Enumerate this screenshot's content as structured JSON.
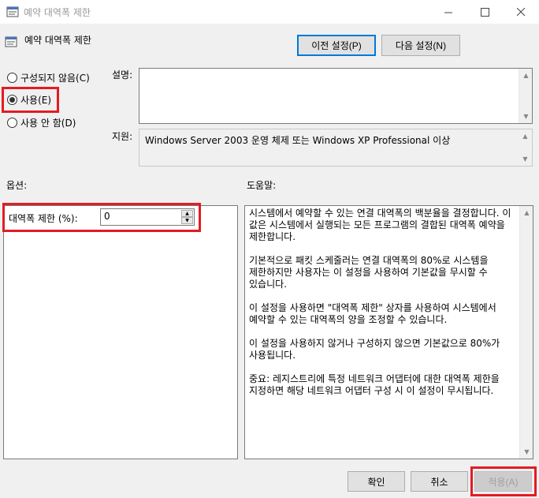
{
  "window": {
    "title": "예약 대역폭 제한",
    "controls": [
      "minimize-icon",
      "maximize-icon",
      "close-icon"
    ]
  },
  "header": {
    "title": "예약 대역폭 제한",
    "prev_setting_label": "이전 설정(P)",
    "next_setting_label": "다음 설정(N)"
  },
  "state": {
    "options": [
      {
        "label": "구성되지 않음(C)",
        "checked": false
      },
      {
        "label": "사용(E)",
        "checked": true
      },
      {
        "label": "사용 안 함(D)",
        "checked": false
      }
    ]
  },
  "comment": {
    "label": "설명:",
    "value": ""
  },
  "supported": {
    "label": "지원:",
    "value": "Windows Server 2003 운영 체제 또는 Windows XP Professional 이상"
  },
  "options_panel": {
    "label": "옵션:",
    "limit_label": "대역폭 제한 (%):",
    "limit_value": "0"
  },
  "help_panel": {
    "label": "도움말:",
    "text": "시스템에서 예약할 수 있는 연결 대역폭의 백분율을 결정합니다. 이 값은 시스템에서 실행되는 모든 프로그램의 결합된 대역폭 예약을 제한합니다.\n\n기본적으로 패킷 스케줄러는 연결 대역폭의 80%로 시스템을 제한하지만 사용자는 이 설정을 사용하여 기본값을 무시할 수 있습니다.\n\n이 설정을 사용하면 \"대역폭 제한\" 상자를 사용하여 시스템에서 예약할 수 있는 대역폭의 양을 조정할 수 있습니다.\n\n이 설정을 사용하지 않거나 구성하지 않으면 기본값으로 80%가 사용됩니다.\n\n중요: 레지스트리에 특정 네트워크 어댑터에 대한 대역폭 제한을 지정하면 해당 네트워크 어댑터 구성 시 이 설정이 무시됩니다."
  },
  "footer": {
    "ok_label": "확인",
    "cancel_label": "취소",
    "apply_label": "적용(A)"
  },
  "colors": {
    "highlight": "#e31b23",
    "focus_border": "#0078d7"
  }
}
